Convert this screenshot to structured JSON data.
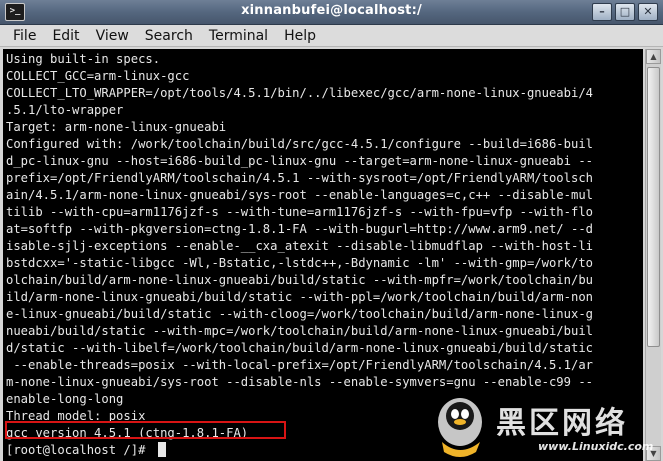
{
  "window": {
    "title": "xinnanbufei@localhost:/",
    "icon_glyph": ">_",
    "buttons": {
      "minimize": "–",
      "maximize": "□",
      "close": "✕"
    }
  },
  "menu": [
    "File",
    "Edit",
    "View",
    "Search",
    "Terminal",
    "Help"
  ],
  "terminal": {
    "lines": [
      "Using built-in specs.",
      "COLLECT_GCC=arm-linux-gcc",
      "COLLECT_LTO_WRAPPER=/opt/tools/4.5.1/bin/../libexec/gcc/arm-none-linux-gnueabi/4",
      ".5.1/lto-wrapper",
      "Target: arm-none-linux-gnueabi",
      "Configured with: /work/toolchain/build/src/gcc-4.5.1/configure --build=i686-buil",
      "d_pc-linux-gnu --host=i686-build_pc-linux-gnu --target=arm-none-linux-gnueabi --",
      "prefix=/opt/FriendlyARM/toolschain/4.5.1 --with-sysroot=/opt/FriendlyARM/toolsch",
      "ain/4.5.1/arm-none-linux-gnueabi/sys-root --enable-languages=c,c++ --disable-mul",
      "tilib --with-cpu=arm1176jzf-s --with-tune=arm1176jzf-s --with-fpu=vfp --with-flo",
      "at=softfp --with-pkgversion=ctng-1.8.1-FA --with-bugurl=http://www.arm9.net/ --d",
      "isable-sjlj-exceptions --enable-__cxa_atexit --disable-libmudflap --with-host-li",
      "bstdcxx='-static-libgcc -Wl,-Bstatic,-lstdc++,-Bdynamic -lm' --with-gmp=/work/to",
      "olchain/build/arm-none-linux-gnueabi/build/static --with-mpfr=/work/toolchain/bu",
      "ild/arm-none-linux-gnueabi/build/static --with-ppl=/work/toolchain/build/arm-non",
      "e-linux-gnueabi/build/static --with-cloog=/work/toolchain/build/arm-none-linux-g",
      "nueabi/build/static --with-mpc=/work/toolchain/build/arm-none-linux-gnueabi/buil",
      "d/static --with-libelf=/work/toolchain/build/arm-none-linux-gnueabi/build/static",
      " --enable-threads=posix --with-local-prefix=/opt/FriendlyARM/toolschain/4.5.1/ar",
      "m-none-linux-gnueabi/sys-root --disable-nls --enable-symvers=gnu --enable-c99 --",
      "enable-long-long",
      "Thread model: posix",
      "gcc version 4.5.1 (ctng-1.8.1-FA)",
      "[root@localhost /]# "
    ],
    "highlighted_line_index": 22,
    "highlight_color": "#d81414"
  },
  "watermark": {
    "big_text": "黑区网络",
    "url": "www.Linuxidc.com"
  }
}
